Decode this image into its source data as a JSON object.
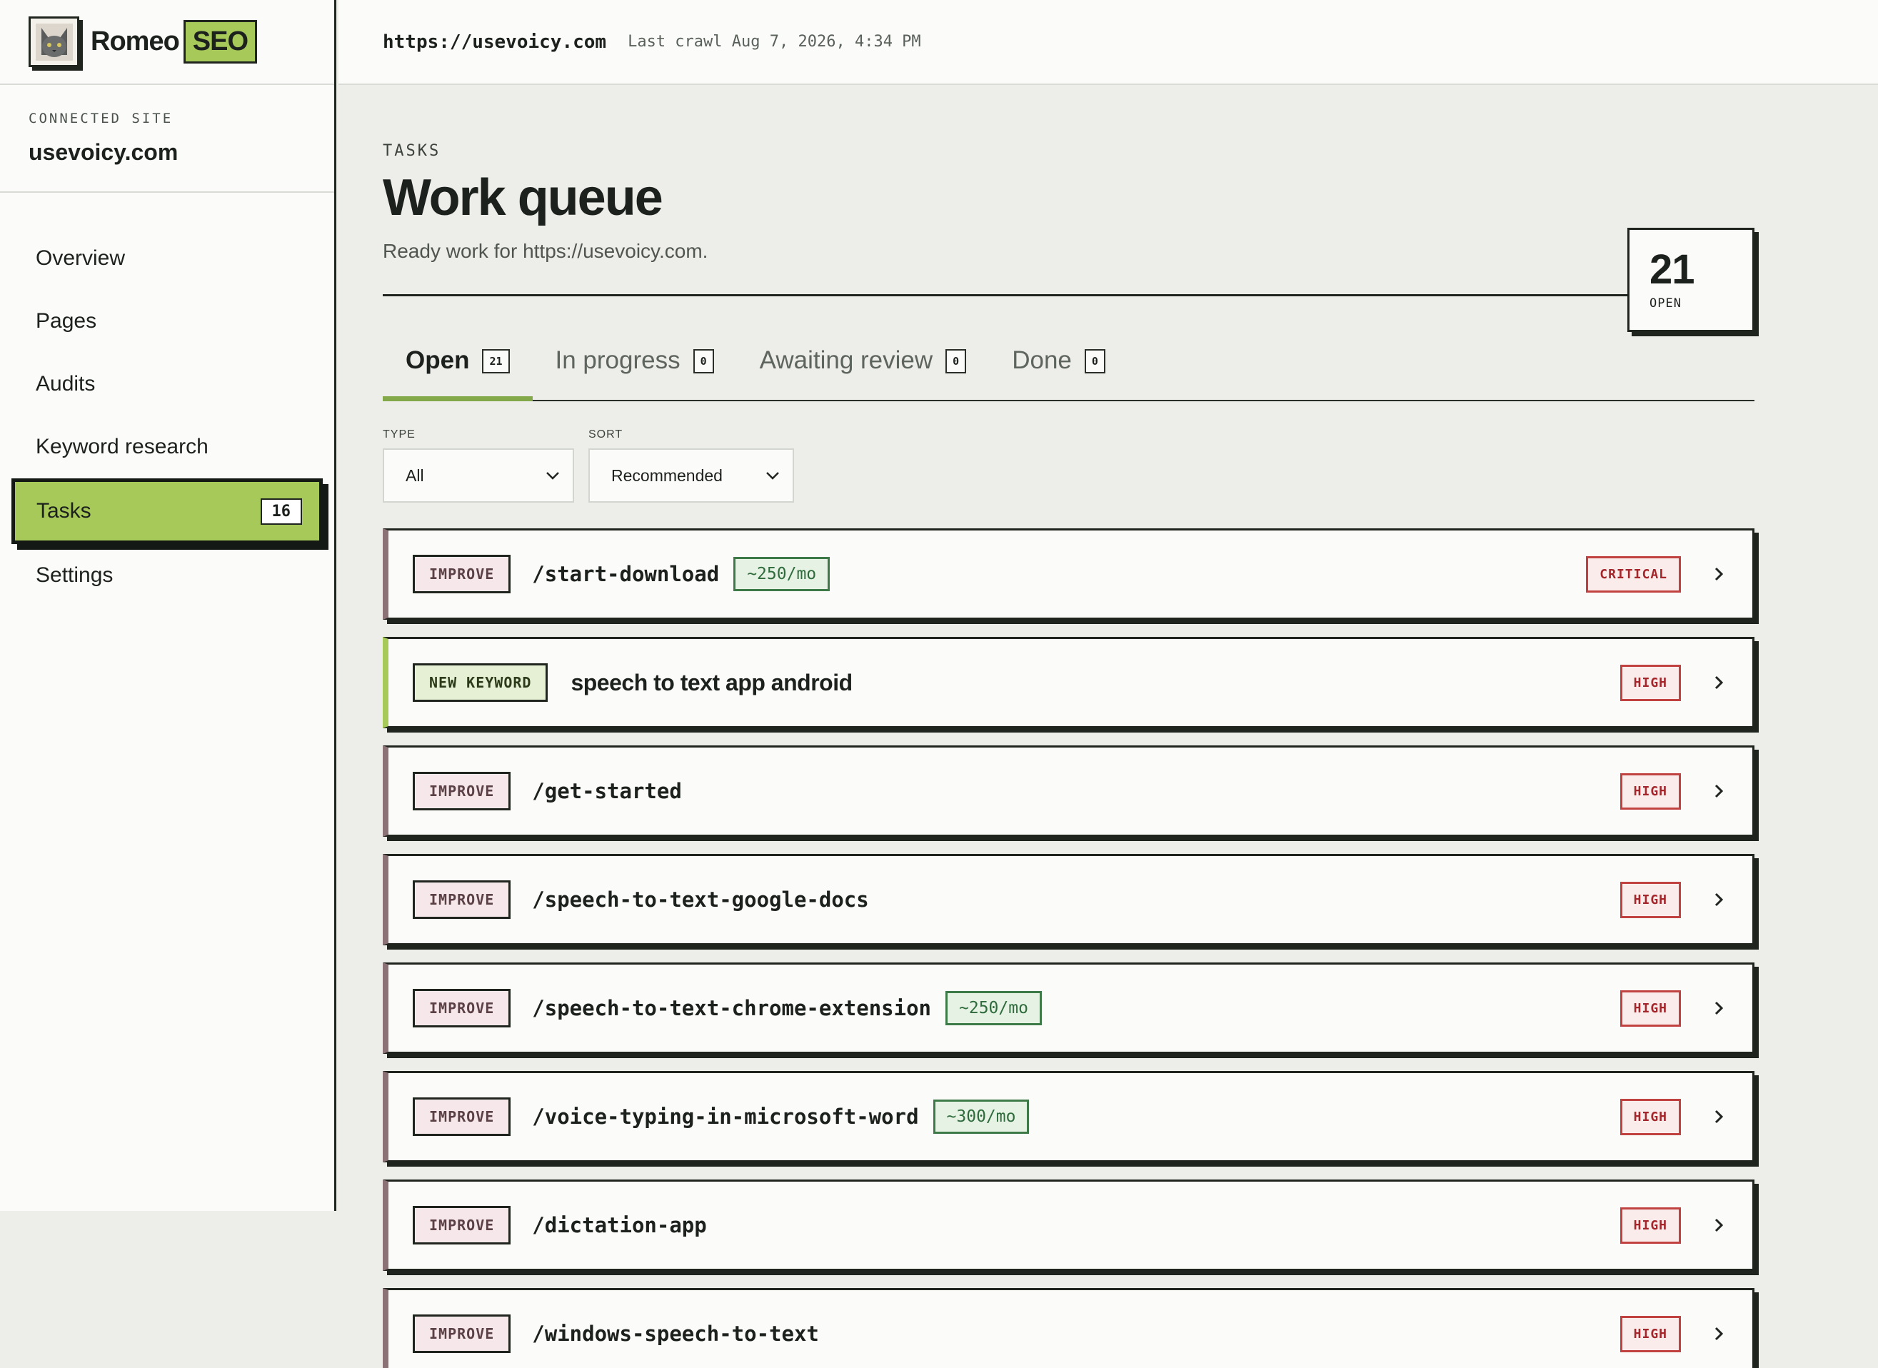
{
  "brand": {
    "name": "Romeo",
    "badge": "SEO"
  },
  "site": {
    "caption": "CONNECTED SITE",
    "name": "usevoicy.com"
  },
  "nav": [
    {
      "label": "Overview"
    },
    {
      "label": "Pages"
    },
    {
      "label": "Audits"
    },
    {
      "label": "Keyword research"
    },
    {
      "label": "Tasks",
      "badge": "16",
      "active": true
    },
    {
      "label": "Settings"
    }
  ],
  "topbar": {
    "url": "https://usevoicy.com",
    "crawl": "Last crawl Aug 7, 2026, 4:34 PM"
  },
  "header": {
    "eyebrow": "TASKS",
    "title": "Work queue",
    "subtitle": "Ready work for https://usevoicy.com.",
    "open_count": "21",
    "open_label": "OPEN"
  },
  "tabs": [
    {
      "label": "Open",
      "count": "21",
      "active": true
    },
    {
      "label": "In progress",
      "count": "0"
    },
    {
      "label": "Awaiting review",
      "count": "0"
    },
    {
      "label": "Done",
      "count": "0"
    }
  ],
  "filters": {
    "type": {
      "label": "TYPE",
      "value": "All"
    },
    "sort": {
      "label": "SORT",
      "value": "Recommended"
    }
  },
  "tasks": [
    {
      "type": "IMPROVE",
      "title": "/start-download",
      "volume": "~250/mo",
      "priority": "CRITICAL"
    },
    {
      "type": "NEW KEYWORD",
      "title": "speech to text app android",
      "volume": "",
      "priority": "HIGH"
    },
    {
      "type": "IMPROVE",
      "title": "/get-started",
      "volume": "",
      "priority": "HIGH"
    },
    {
      "type": "IMPROVE",
      "title": "/speech-to-text-google-docs",
      "volume": "",
      "priority": "HIGH"
    },
    {
      "type": "IMPROVE",
      "title": "/speech-to-text-chrome-extension",
      "volume": "~250/mo",
      "priority": "HIGH"
    },
    {
      "type": "IMPROVE",
      "title": "/voice-typing-in-microsoft-word",
      "volume": "~300/mo",
      "priority": "HIGH"
    },
    {
      "type": "IMPROVE",
      "title": "/dictation-app",
      "volume": "",
      "priority": "HIGH"
    },
    {
      "type": "IMPROVE",
      "title": "/windows-speech-to-text",
      "volume": "",
      "priority": "HIGH"
    }
  ],
  "colors": {
    "accent": "#a6c95a",
    "critical": "#a4262b",
    "volume": "#2f6b3c"
  }
}
